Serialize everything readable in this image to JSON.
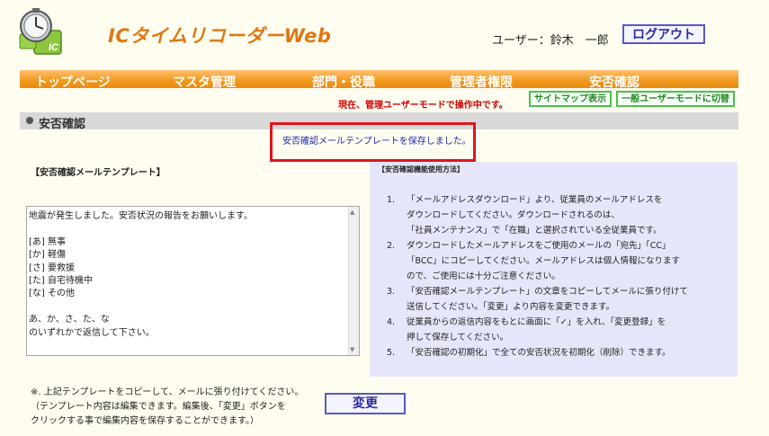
{
  "header": {
    "app_title": "ICタイムリコーダーWeb",
    "user_label": "ユーザー：鈴木　一郎",
    "logout_label": "ログアウト",
    "logo_text": "IC"
  },
  "nav": {
    "items": [
      "トップページ",
      "マスタ管理",
      "部門・役職",
      "管理者権限",
      "安否確認"
    ]
  },
  "mode": {
    "status_text": "現在、管理ユーザーモードで操作中です。",
    "sitemap_label": "サイトマップ表示",
    "user_mode_label": "一般ユーザーモードに切替"
  },
  "section": {
    "title": "安否確認"
  },
  "message": {
    "saved_text": "安否確認メールテンプレートを保存しました。"
  },
  "template": {
    "heading": "【安否確認メールテンプレート】",
    "content": "地震が発生しました。安否状況の報告をお願いします。\n\n[あ] 無事\n[か] 軽傷\n[さ] 要救援\n[た] 自宅待機中\n[な] その他\n\nあ、か、さ、た、な\nのいずれかで返信して下さい。"
  },
  "help": {
    "heading": "【安否確認機能使用方法】",
    "items": [
      {
        "num": "1.",
        "text": "「メールアドレスダウンロード」より、従業員のメールアドレスを\nダウンロードしてください。ダウンロードされるのは、\n「社員メンテナンス」で「在職」と選択されている全従業員です。"
      },
      {
        "num": "2.",
        "text": "ダウンロードしたメールアドレスをご使用のメールの「宛先」「CC」\n「BCC」にコピーしてください。メールアドレスは個人情報になります\nので、ご使用には十分ご注意ください。"
      },
      {
        "num": "3.",
        "text": "「安否確認メールテンプレート」の文章をコピーしてメールに張り付けて\n送信してください。「変更」より内容を変更できます。"
      },
      {
        "num": "4.",
        "text": "従業員からの返信内容をもとに画面に「✓」を入れ、「変更登録」を\n押して保存してください。"
      },
      {
        "num": "5.",
        "text": "「安否確認の初期化」で全ての安否状況を初期化（削除）できます。"
      }
    ]
  },
  "footer": {
    "note": "※. 上記テンプレートをコピーして、メールに張り付けてください。\n（テンプレート内容は編集できます。編集後、「変更」ボタンを\nクリックする事で編集内容を保存することができます。）",
    "update_label": "変更"
  }
}
